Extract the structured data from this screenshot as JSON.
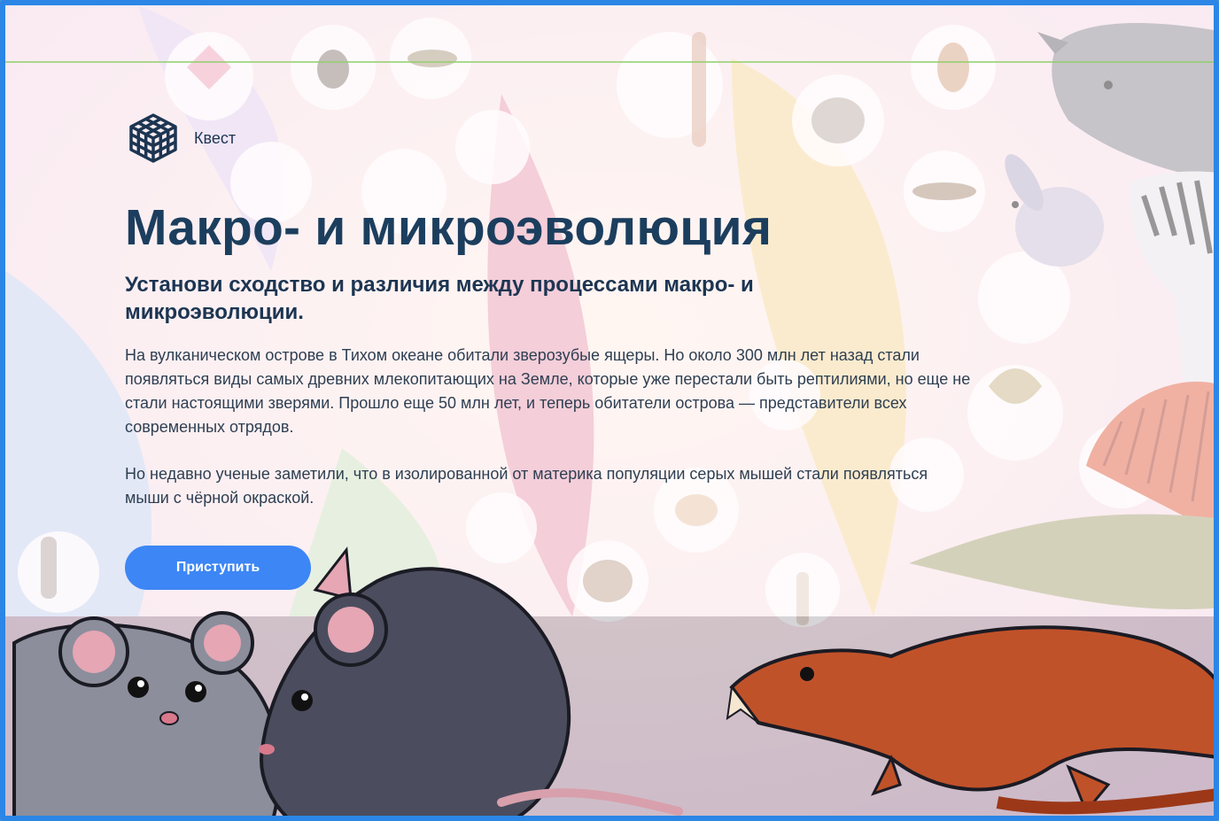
{
  "brand": {
    "label": "Квест",
    "icon": "cube-grid-icon"
  },
  "title": "Макро- и микроэволюция",
  "subtitle": "Установи сходство и различия между процессами макро- и микроэволюции.",
  "paragraphs": [
    "На вулканическом острове в Тихом океане обитали зверозубые ящеры. Но около 300 млн лет назад стали появляться виды самых древних млекопитающих на Земле, которые уже перестали быть рептилиями, но еще не стали настоящими зверями. Прошло еще 50 млн лет, и теперь обитатели острова — представители всех современных отрядов.",
    "Но недавно ученые заметили, что в изолированной от материка популяции серых мышей стали появляться мыши с чёрной окраской."
  ],
  "start_button": {
    "label": "Приступить"
  },
  "colors": {
    "accent": "#3d86f5",
    "title": "#1c3e5e",
    "frame": "#2b86e6"
  }
}
